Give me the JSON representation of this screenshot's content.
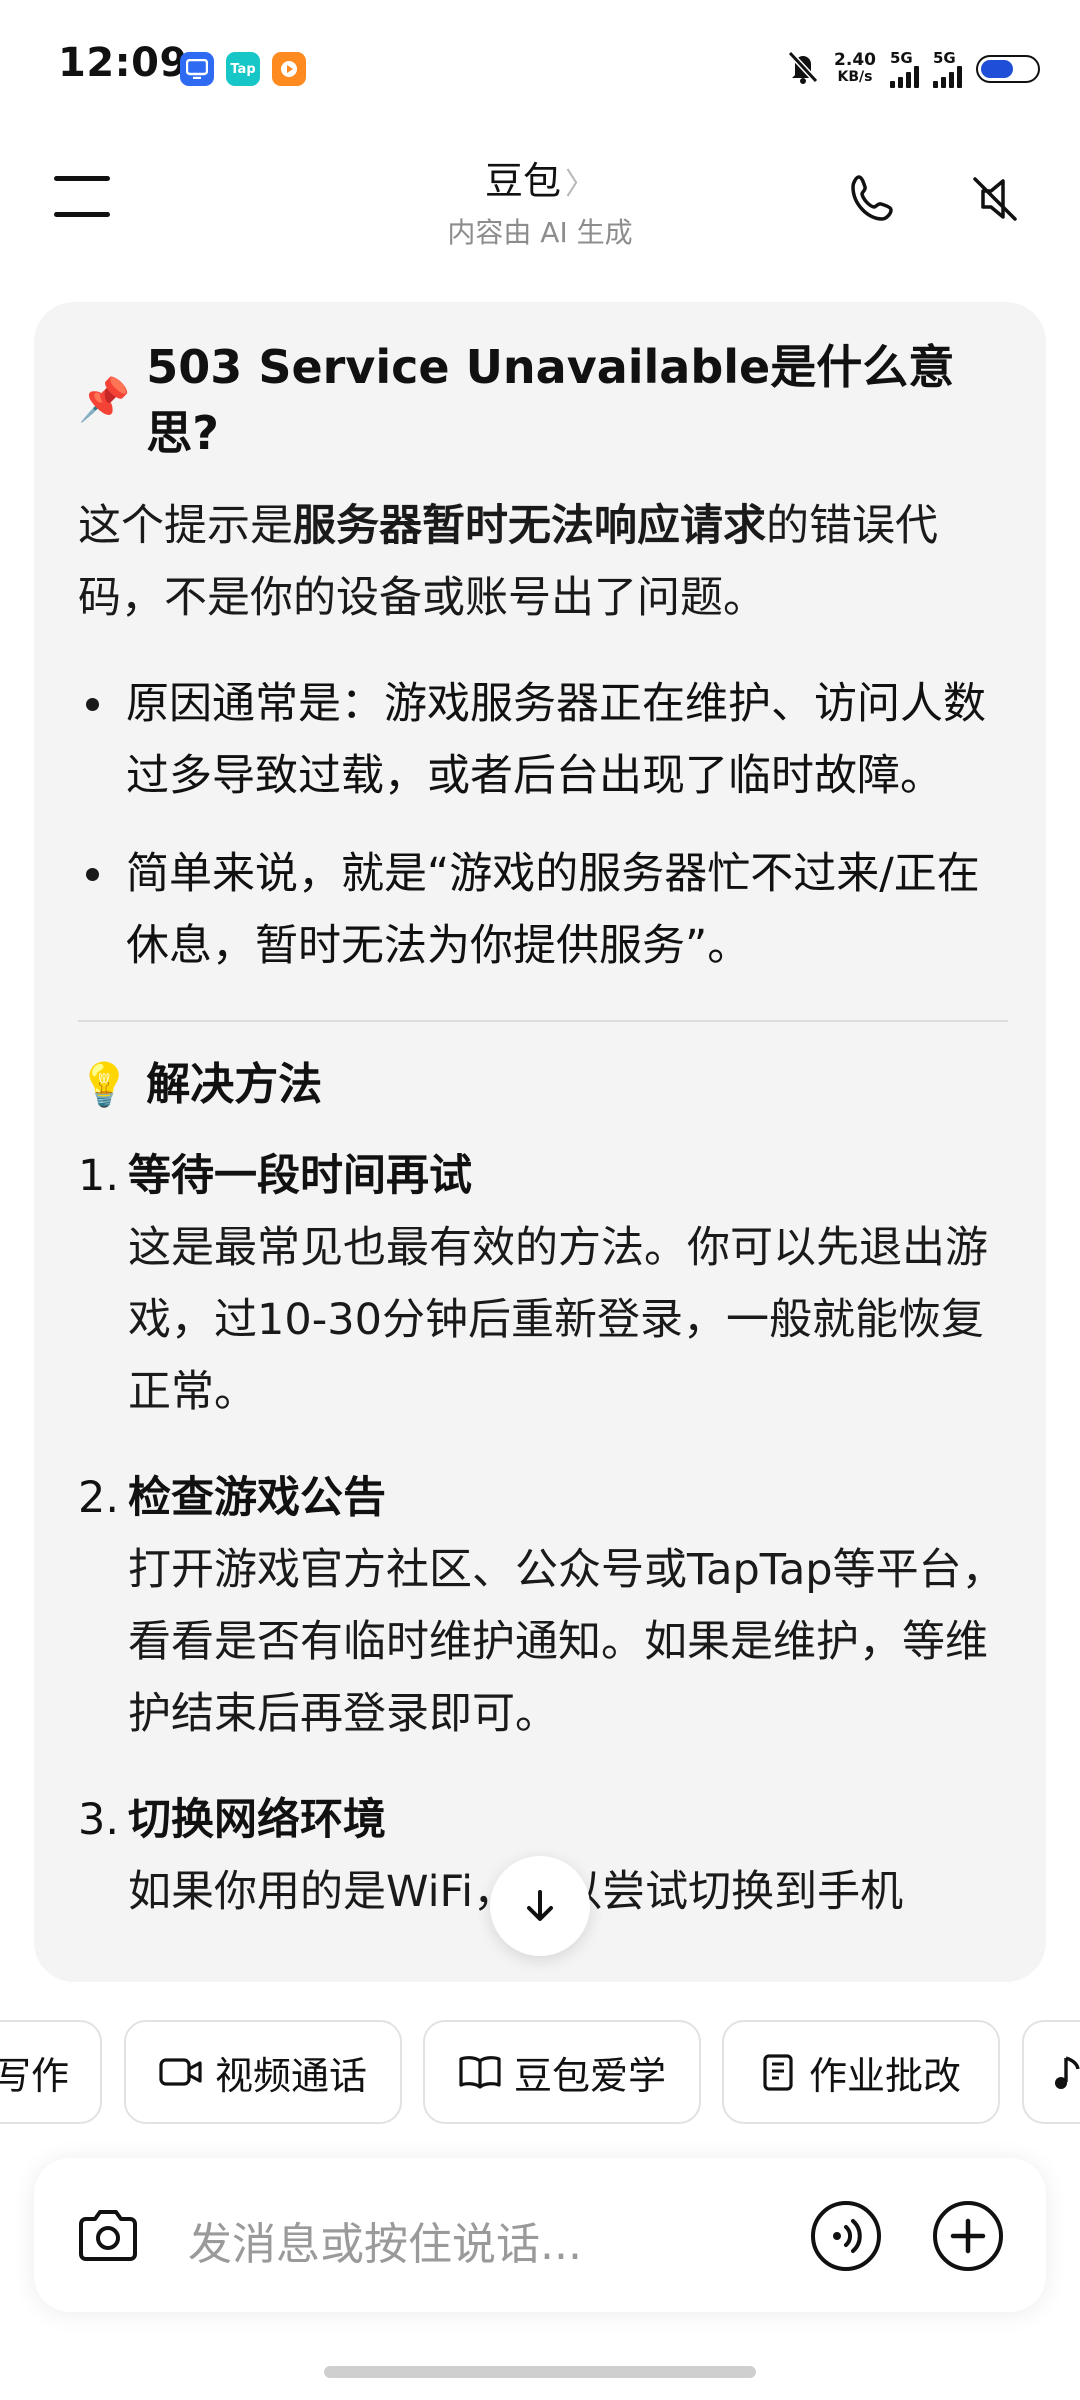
{
  "status_bar": {
    "time": "12:09",
    "net_speed_value": "2.40",
    "net_speed_unit": "KB/s",
    "signal1_label": "5G",
    "signal2_label": "5G",
    "app_badges": [
      "",
      "Tap",
      ""
    ],
    "battery_level": 0.6
  },
  "header": {
    "title": "豆包",
    "title_chevron": "〉",
    "subtitle": "内容由 AI 生成"
  },
  "message": {
    "heading_emoji": "📌",
    "heading": "503 Service Unavailable是什么意思?",
    "intro_part1": "这个提示是",
    "intro_bold": "服务器暂时无法响应请求",
    "intro_part2": "的错误代码，不是你的设备或账号出了问题。",
    "bullets": [
      "原因通常是：游戏服务器正在维护、访问人数过多导致过载，或者后台出现了临时故障。",
      "简单来说，就是“游戏的服务器忙不过来/正在休息，暂时无法为你提供服务”。"
    ],
    "solutions_emoji": "💡",
    "solutions_heading": "解决方法",
    "solutions": [
      {
        "num": "1.",
        "title": "等待一段时间再试",
        "text": "这是最常见也最有效的方法。你可以先退出游戏，过10-30分钟后重新登录，一般就能恢复正常。"
      },
      {
        "num": "2.",
        "title": "检查游戏公告",
        "text": "打开游戏官方社区、公众号或TapTap等平台，看看是否有临时维护通知。如果是维护，等维护结束后再登录即可。"
      },
      {
        "num": "3.",
        "title": "切换网络环境",
        "text": "如果你用的是WiFi，可以尝试切换到手机"
      }
    ]
  },
  "chips": [
    {
      "label": "写作",
      "icon": "pen-icon"
    },
    {
      "label": "视频通话",
      "icon": "video-camera-icon"
    },
    {
      "label": "豆包爱学",
      "icon": "book-icon"
    },
    {
      "label": "作业批改",
      "icon": "homework-icon"
    },
    {
      "label": "",
      "icon": "music-note-icon"
    }
  ],
  "input": {
    "placeholder": "发消息或按住说话..."
  },
  "colors": {
    "card_bg": "#f4f4f5",
    "battery_fill": "#1f4fd6",
    "muted_text": "#8d8d8d"
  }
}
